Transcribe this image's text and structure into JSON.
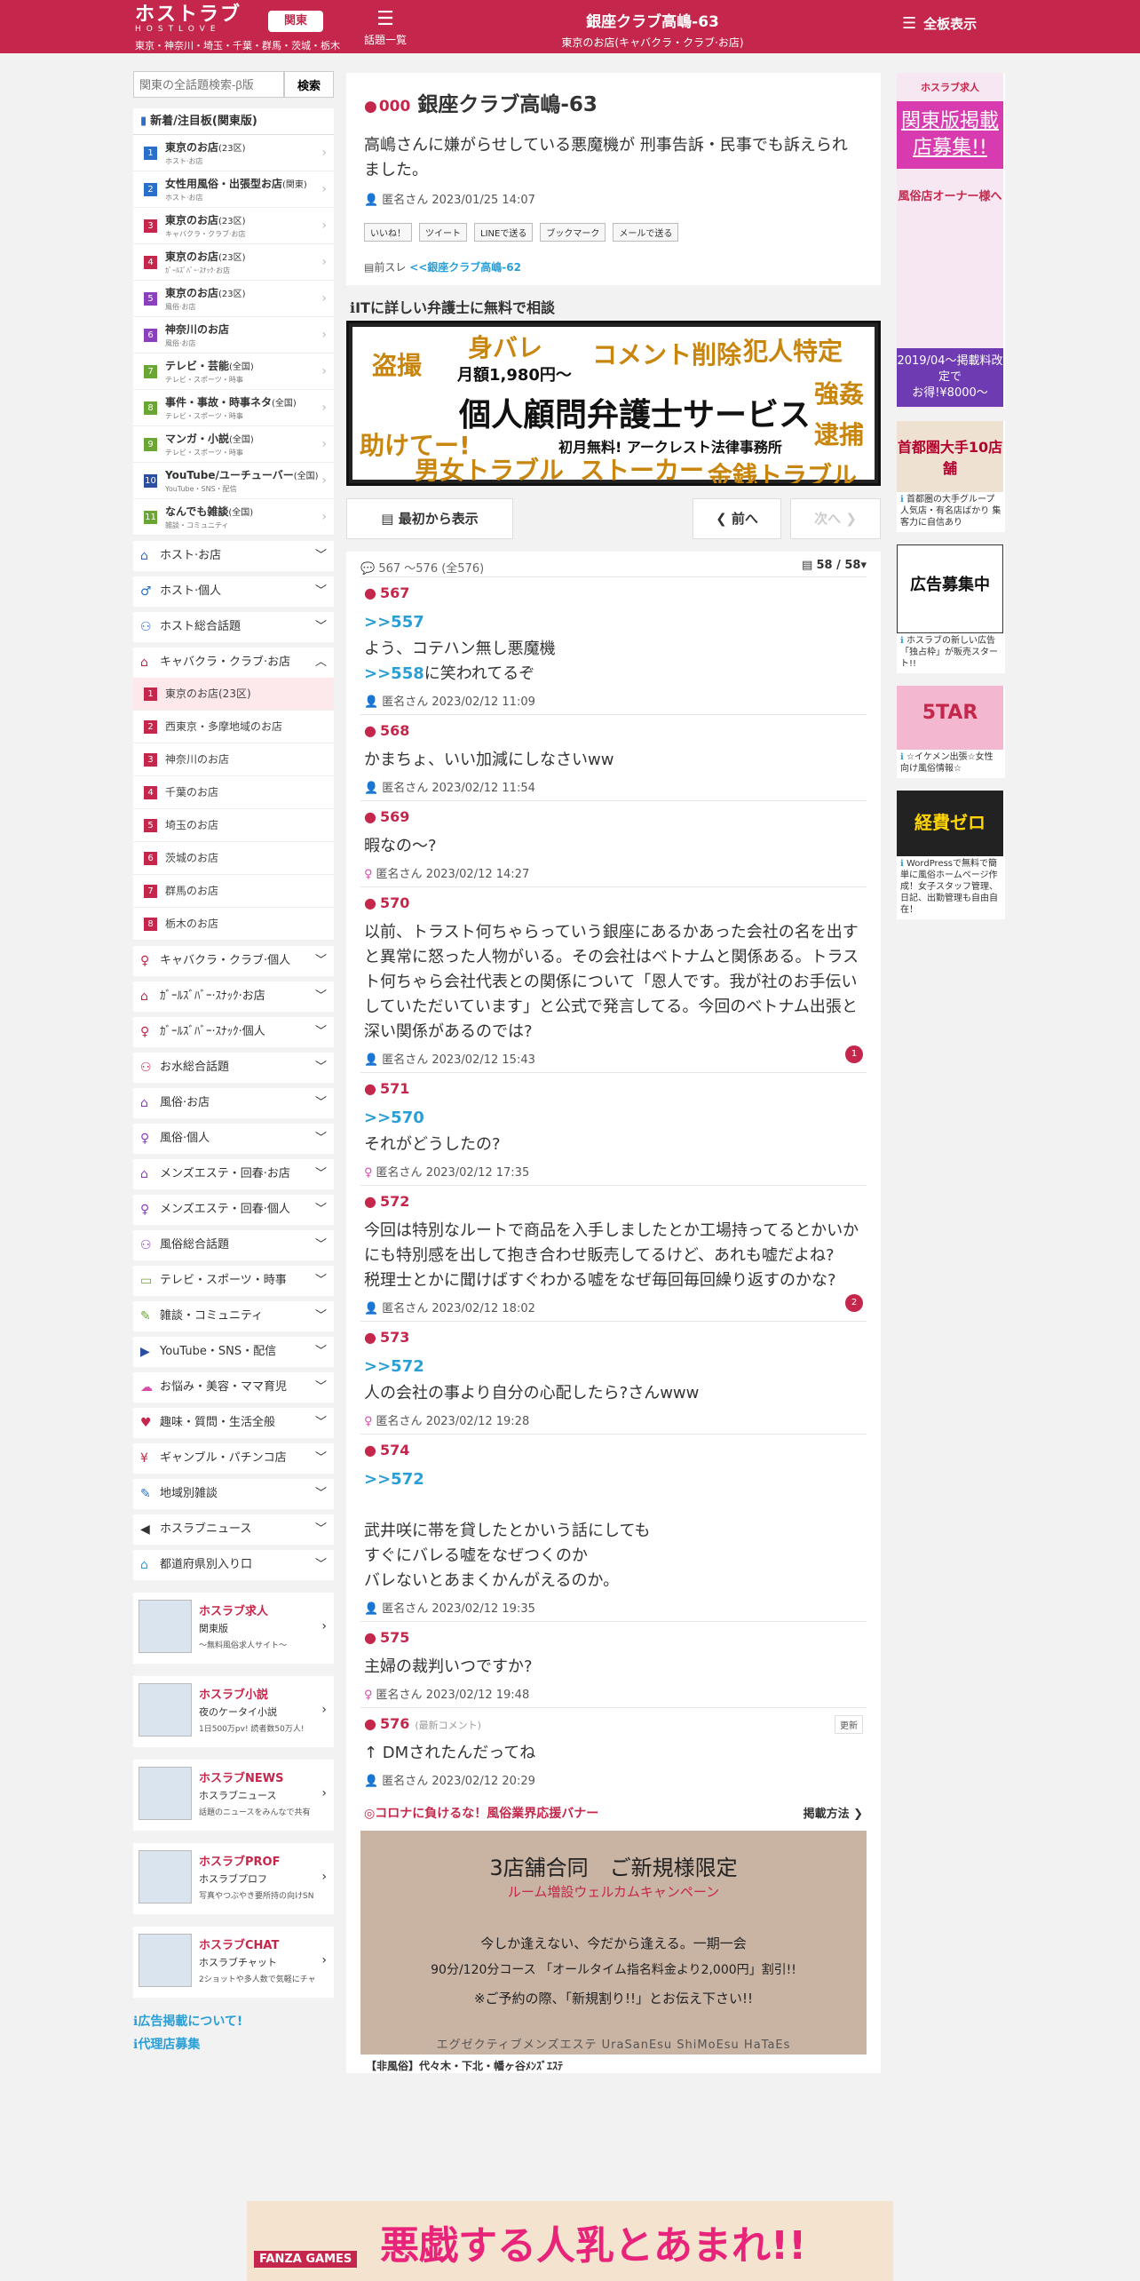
{
  "header": {
    "logo_main": "ホストラブ",
    "logo_sub": "HOSTLOVE",
    "regions": "東京・神奈川・埼玉・千葉・群馬・茨城・栃木",
    "region_button": "関東",
    "topic_list_label": "話題一覧",
    "board_title": "銀座クラブ高嶋-63",
    "board_subtitle": "東京のお店(キャバクラ・クラブ·お店)",
    "all_boards_label": "全板表示",
    "brand_color": "#c4274b"
  },
  "search": {
    "placeholder": "関東の全話題検索-β版",
    "button": "検索"
  },
  "popular": {
    "header": "新着/注目板(関東版)",
    "items": [
      {
        "num": "1",
        "name": "東京のお店",
        "tag": "(23区)",
        "sub": "ホスト·お店",
        "color": "#2a6fc9"
      },
      {
        "num": "2",
        "name": "女性用風俗・出張型お店",
        "tag": "(関東)",
        "sub": "ホスト·お店",
        "color": "#2a6fc9"
      },
      {
        "num": "3",
        "name": "東京のお店",
        "tag": "(23区)",
        "sub": "キャバクラ・クラブ·お店",
        "color": "#c4274b"
      },
      {
        "num": "4",
        "name": "東京のお店",
        "tag": "(23区)",
        "sub": "ｶﾞｰﾙｽﾞﾊﾞｰ·ｽﾅｯｸ·お店",
        "color": "#c4274b"
      },
      {
        "num": "5",
        "name": "東京のお店",
        "tag": "(23区)",
        "sub": "風俗·お店",
        "color": "#8a3fbd"
      },
      {
        "num": "6",
        "name": "神奈川のお店",
        "tag": "",
        "sub": "風俗·お店",
        "color": "#8a3fbd"
      },
      {
        "num": "7",
        "name": "テレビ・芸能",
        "tag": "(全国)",
        "sub": "テレビ・スポーツ・時事",
        "color": "#6aa633"
      },
      {
        "num": "8",
        "name": "事件・事故・時事ネタ",
        "tag": "(全国)",
        "sub": "テレビ・スポーツ・時事",
        "color": "#6aa633"
      },
      {
        "num": "9",
        "name": "マンガ・小説",
        "tag": "(全国)",
        "sub": "テレビ・スポーツ・時事",
        "color": "#6aa633"
      },
      {
        "num": "10",
        "name": "YouTube/ユーチューバー",
        "tag": "(全国)",
        "sub": "YouTube・SNS・配信",
        "color": "#2a4fa0"
      },
      {
        "num": "11",
        "name": "なんでも雑談",
        "tag": "(全国)",
        "sub": "雑談・コミュニティ",
        "color": "#6aa633"
      }
    ]
  },
  "categories_top": [
    {
      "label": "ホスト·お店",
      "icon": "house-icon",
      "glyph": "⌂",
      "color": "#2a6fc9"
    },
    {
      "label": "ホスト·個人",
      "icon": "person-icon",
      "glyph": "♂",
      "color": "#2a6fc9"
    },
    {
      "label": "ホスト総合話題",
      "icon": "people-icon",
      "glyph": "⚇",
      "color": "#2a6fc9"
    }
  ],
  "cabaret": {
    "label": "キャバクラ・クラブ·お店",
    "subs": [
      "東京のお店(23区)",
      "西東京・多摩地域のお店",
      "神奈川のお店",
      "千葉のお店",
      "埼玉のお店",
      "茨城のお店",
      "群馬のお店",
      "栃木のお店"
    ]
  },
  "categories_bottom": [
    {
      "label": "キャバクラ・クラブ·個人",
      "glyph": "♀",
      "color": "#c4274b"
    },
    {
      "label": "ｶﾞｰﾙｽﾞﾊﾞｰ·ｽﾅｯｸ·お店",
      "glyph": "⌂",
      "color": "#c4274b"
    },
    {
      "label": "ｶﾞｰﾙｽﾞﾊﾞｰ·ｽﾅｯｸ·個人",
      "glyph": "♀",
      "color": "#c4274b"
    },
    {
      "label": "お水総合話題",
      "glyph": "⚇",
      "color": "#c4274b"
    },
    {
      "label": "風俗·お店",
      "glyph": "⌂",
      "color": "#8a3fbd"
    },
    {
      "label": "風俗·個人",
      "glyph": "♀",
      "color": "#8a3fbd"
    },
    {
      "label": "メンズエステ・回春·お店",
      "glyph": "⌂",
      "color": "#8a3fbd"
    },
    {
      "label": "メンズエステ・回春·個人",
      "glyph": "♀",
      "color": "#8a3fbd"
    },
    {
      "label": "風俗総合話題",
      "glyph": "⚇",
      "color": "#8a3fbd"
    },
    {
      "label": "テレビ・スポーツ・時事",
      "glyph": "▭",
      "color": "#6aa633"
    },
    {
      "label": "雑談・コミュニティ",
      "glyph": "✎",
      "color": "#6aa633"
    },
    {
      "label": "YouTube・SNS・配信",
      "glyph": "▶",
      "color": "#2a4fa0"
    },
    {
      "label": "お悩み・美容・ママ育児",
      "glyph": "☁",
      "color": "#d84ca8"
    },
    {
      "label": "趣味・質問・生活全般",
      "glyph": "♥",
      "color": "#c4274b"
    },
    {
      "label": "ギャンブル・パチンコ店",
      "glyph": "¥",
      "color": "#c4274b"
    },
    {
      "label": "地域別雑談",
      "glyph": "✎",
      "color": "#2a6fc9"
    },
    {
      "label": "ホスラブニュース",
      "glyph": "◀",
      "color": "#333333"
    },
    {
      "label": "都道府県別入り口",
      "glyph": "⌂",
      "color": "#2a9fd6"
    }
  ],
  "side_ads": [
    {
      "title": "ホスラブ求人",
      "sub": "関東版",
      "desc": "〜無料風俗求人サイト〜"
    },
    {
      "title": "ホスラブ小説",
      "sub": "夜のケータイ小説",
      "desc": "1日500万pv! 読者数50万人!"
    },
    {
      "title": "ホスラブNEWS",
      "sub": "ホスラブニュース",
      "desc": "話題のニュースをみんなで共有"
    },
    {
      "title": "ホスラブPROF",
      "sub": "ホスラブプロフ",
      "desc": "写真やつぶやき要所持の向けSNS"
    },
    {
      "title": "ホスラブCHAT",
      "sub": "ホスラブチャット",
      "desc": "2ショットや多人数で気軽にチャット"
    }
  ],
  "left_links": [
    "広告掲載について!",
    "代理店募集"
  ],
  "thread": {
    "number": "000",
    "title": "銀座クラブ高嶋-63",
    "body": "高嶋さんに嫌がらせしている悪魔機が 刑事告訴・民事でも訴えられました。",
    "author": "匿名さん",
    "date": "2023/01/25 14:07",
    "share": [
      "いいね！",
      "ツイート",
      "LINEで送る",
      "ブックマーク",
      "メールで送る"
    ],
    "prev_label": "前スレ",
    "prev_link": "<<銀座クラブ高嶋-62"
  },
  "lawyer_title": "ITに詳しい弁護士に無料で相談",
  "lawyer_banner": {
    "words": [
      "盗撮",
      "身バレ",
      "コメント削除",
      "犯人特定",
      "強姦",
      "逮捕",
      "助けてー!",
      "男女トラブル",
      "ストーカー",
      "金銭トラブル"
    ],
    "price": "月額1,980円〜",
    "service": "個人顧問弁護士サービス",
    "note": "初月無料! アークレスト法律事務所"
  },
  "nav": {
    "first": "最初から表示",
    "prev": "前へ",
    "next": "次へ"
  },
  "range": {
    "text": "567 〜576 (全576)",
    "page": "58 / 58"
  },
  "responses": [
    {
      "no": "567",
      "anchor": ">>557",
      "text": "よう、コテハン無し悪魔機",
      "anchor2": ">>558",
      "text2": "に笑われてるぞ",
      "author": "匿名さん",
      "date": "2023/02/12 11:09",
      "gender": "m"
    },
    {
      "no": "568",
      "text": "かまちょ、いい加減にしなさいww",
      "author": "匿名さん",
      "date": "2023/02/12 11:54",
      "gender": "m"
    },
    {
      "no": "569",
      "text": "暇なの〜?",
      "author": "匿名さん",
      "date": "2023/02/12 14:27",
      "gender": "f"
    },
    {
      "no": "570",
      "text": "以前、トラスト何ちゃらっていう銀座にあるかあった会社の名を出すと異常に怒った人物がいる。その会社はベトナムと関係ある。トラスト何ちゃら会社代表との関係について「恩人です。我が社のお手伝いしていただいています」と公式で発言してる。今回のベトナム出張と深い関係があるのでは?",
      "author": "匿名さん",
      "date": "2023/02/12 15:43",
      "gender": "m",
      "badge": "1"
    },
    {
      "no": "571",
      "anchor": ">>570",
      "text": "それがどうしたの?",
      "author": "匿名さん",
      "date": "2023/02/12 17:35",
      "gender": "f"
    },
    {
      "no": "572",
      "text": "今回は特別なルートで商品を入手しましたとか工場持ってるとかいかにも特別感を出して抱き合わせ販売してるけど、あれも嘘だよね?　税理士とかに聞けばすぐわかる嘘をなぜ毎回毎回繰り返すのかな?",
      "author": "匿名さん",
      "date": "2023/02/12 18:02",
      "gender": "m",
      "badge": "2"
    },
    {
      "no": "573",
      "anchor": ">>572",
      "text": "人の会社の事より自分の心配したら?さんwww",
      "author": "匿名さん",
      "date": "2023/02/12 19:28",
      "gender": "f"
    },
    {
      "no": "574",
      "anchor": ">>572",
      "text": "\n武井咲に帯を貸したとかいう話にしても\nすぐにバレる嘘をなぜつくのか\nバレないとあまくかんがえるのか。",
      "author": "匿名さん",
      "date": "2023/02/12 19:35",
      "gender": "m"
    },
    {
      "no": "575",
      "text": "主婦の裁判いつですか?",
      "author": "匿名さん",
      "date": "2023/02/12 19:48",
      "gender": "f"
    },
    {
      "no": "576",
      "latest": "(最新コメント)",
      "update": "更新",
      "text": "↑ DMされたんだってね",
      "author": "匿名さん",
      "date": "2023/02/12 20:29",
      "gender": "m"
    }
  ],
  "promo": {
    "header": "◎コロナに負けるな！風俗業界応援バナー",
    "method": "掲載方法",
    "line1": "3店舗合同　ご新規様限定",
    "line2": "ルーム増設ウェルカムキャンペーン",
    "line3": "今しか逢えない、今だから逢える。一期一会",
    "line4": "90分/120分コース 「オールタイム指名料金より2,000円」割引!!",
    "line5": "※ご予約の際、「新規割り!!」とお伝え下さい!!",
    "line6": "エグゼクティブメンズエステ UraSanEsu ShiMoEsu HaTaEs",
    "caption": "【非風俗】代々木・下北・幡ヶ谷ﾒﾝｽﾞｴｽﾃ"
  },
  "right_ads": [
    {
      "title": "ホスラブ求人",
      "big": "関東版掲載店募集!!",
      "owner": "風俗店オーナー様へ",
      "date": "2019/04〜掲載料改定で",
      "deal": "お得!¥8000〜"
    },
    {
      "title": "首都圏大手10店舗",
      "caption": "首都圏の大手グループ 人気店・有名店ばかり 集客力に自信あり"
    },
    {
      "title": "広告募集中",
      "caption": "ホスラブの新しい広告「独占枠」が販売スタート!!"
    },
    {
      "title": "5TAR",
      "caption": "☆イケメン出張☆女性向け風俗情報☆"
    },
    {
      "title": "経費ゼロ",
      "caption": "WordPressで無料で簡単に風俗ホームページ作成！女子スタッフ管理、日記、出勤管理も自由自在！"
    }
  ],
  "bottom_ad": {
    "brand": "FANZA GAMES",
    "text": "悪戯する人乳とあまれ!!"
  }
}
